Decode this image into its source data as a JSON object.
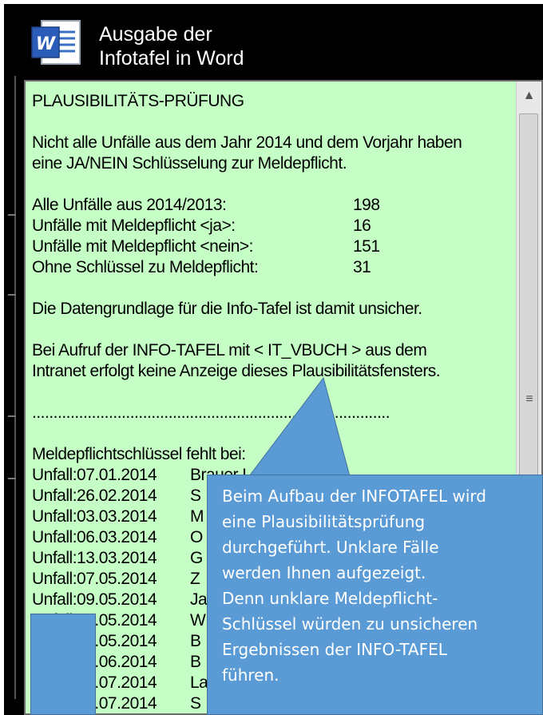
{
  "header": {
    "title_line1": "Ausgabe der",
    "title_line2": "Infotafel in Word",
    "icon": "word-icon"
  },
  "panel": {
    "heading": "PLAUSIBILITÄTS-PRÜFUNG",
    "intro_line1": "Nicht alle Unfälle aus dem Jahr 2014 und dem Vorjahr haben",
    "intro_line2": "eine JA/NEIN Schlüsselung zur Meldepflicht.",
    "stats": [
      {
        "label": "Alle Unfälle aus 2014/2013:",
        "value": "198"
      },
      {
        "label": "Unfälle mit Meldepflicht <ja>:",
        "value": "16"
      },
      {
        "label": "Unfälle mit Meldepflicht <nein>:",
        "value": "151"
      },
      {
        "label": "Ohne Schlüssel zu Meldepflicht:",
        "value": "31"
      }
    ],
    "warning": "Die Datengrundlage für die Info-Tafel ist damit unsicher.",
    "note_line1": "Bei Aufruf der INFO-TAFEL  mit < IT_VBUCH > aus dem",
    "note_line2": "Intranet erfolgt keine Anzeige dieses Plausibilitätsfensters.",
    "dots": "....................................................................................",
    "missing_heading": "Meldepflichtschlüssel fehlt bei:",
    "missing": [
      {
        "date": "Unfall:07.01.2014",
        "name": "Brauer L"
      },
      {
        "date": "Unfall:26.02.2014",
        "name": "S"
      },
      {
        "date": "Unfall:03.03.2014",
        "name": "M"
      },
      {
        "date": "Unfall:06.03.2014",
        "name": "O"
      },
      {
        "date": "Unfall:13.03.2014",
        "name": "G"
      },
      {
        "date": "Unfall:07.05.2014",
        "name": "Z"
      },
      {
        "date": "Unfall:09.05.2014",
        "name": "Ja"
      },
      {
        "date": "Unfall:13.05.2014",
        "name": "W"
      },
      {
        "date": "Unfall:28.05.2014",
        "name": "B"
      },
      {
        "date": "Unfall:05.06.2014",
        "name": "B"
      },
      {
        "date": "Unfall:08.07.2014",
        "name": "La"
      },
      {
        "date": "Unfall:08.07.2014",
        "name": "S"
      }
    ]
  },
  "callout": {
    "lines": [
      "Beim Aufbau der INFOTAFEL wird",
      "eine Plausibilitätsprüfung",
      "durchgeführt. Unklare Fälle",
      "werden Ihnen aufgezeigt.",
      "Denn unklare Meldepflicht-",
      "Schlüssel würden zu unsicheren",
      "Ergebnissen der INFO-TAFEL",
      "führen."
    ]
  },
  "colors": {
    "panel_bg": "#c5ffc5",
    "callout_bg": "#5b9bd5",
    "frame_bg": "#000000"
  }
}
